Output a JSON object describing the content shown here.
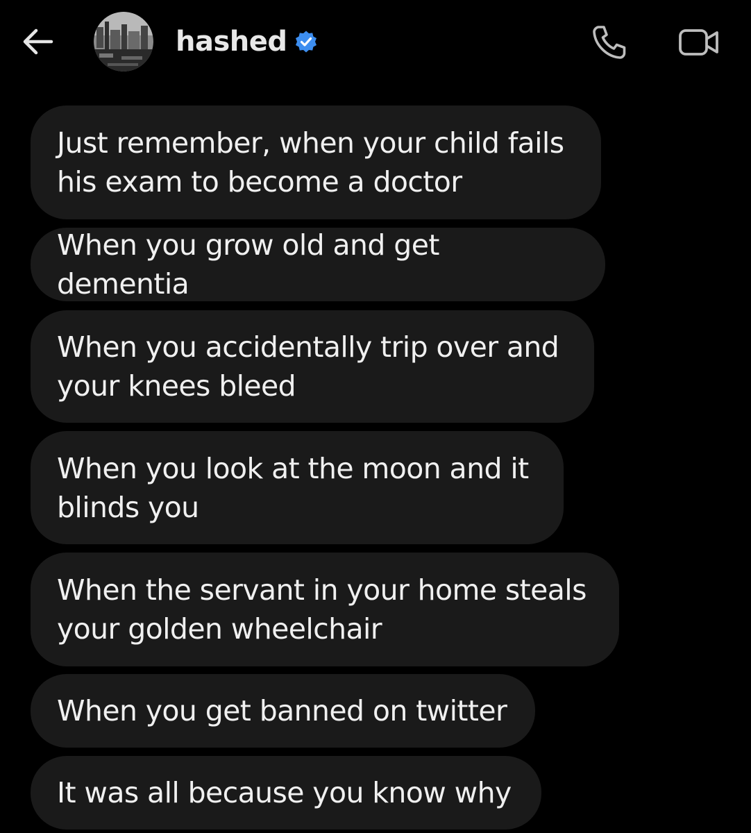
{
  "header": {
    "back_icon": "arrow-left-icon",
    "contact_name": "hashed",
    "verified_icon": "verified-badge-icon",
    "call_icon": "phone-icon",
    "video_icon": "video-camera-icon"
  },
  "colors": {
    "background": "#000000",
    "bubble": "#1a1a1a",
    "text": "#f0f0f0",
    "verified_blue": "#3d8ef0"
  },
  "messages": [
    {
      "text": "Just remember, when your child fails his exam to become a doctor"
    },
    {
      "text": "When you grow old and get dementia"
    },
    {
      "text": "When you accidentally trip over and your knees bleed"
    },
    {
      "text": "When you look at the moon and it blinds you"
    },
    {
      "text": "When the servant in your home steals your golden wheelchair"
    },
    {
      "text": "When you get banned on twitter"
    },
    {
      "text": "It was all because you know why"
    }
  ]
}
